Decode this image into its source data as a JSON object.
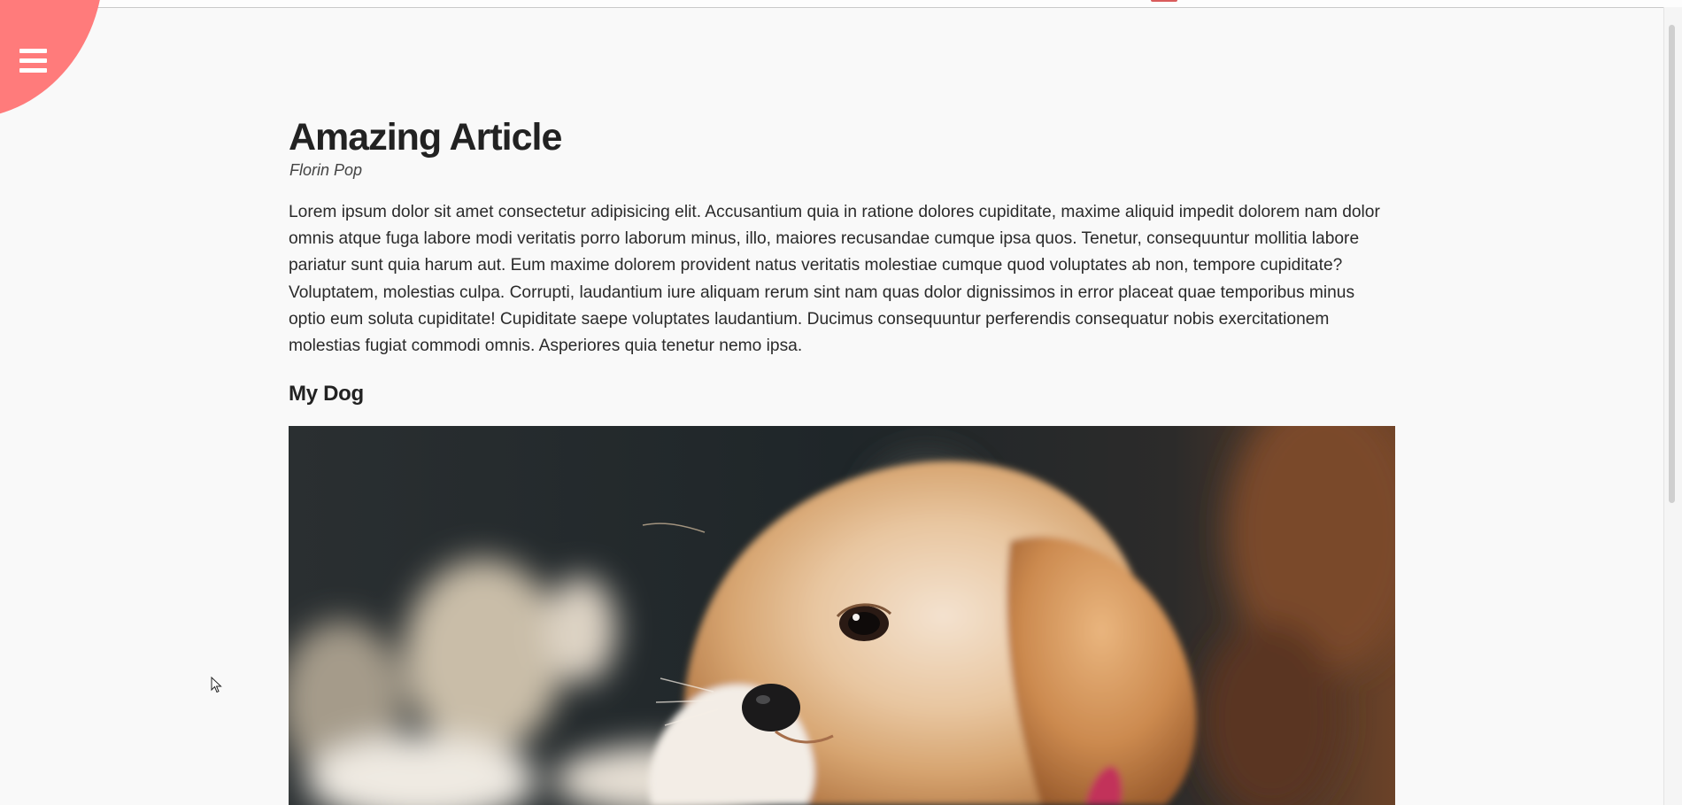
{
  "menu": {
    "icon": "hamburger-menu-icon",
    "accent_color": "#ff7b7b"
  },
  "article": {
    "title": "Amazing Article",
    "author": "Florin Pop",
    "body": "Lorem ipsum dolor sit amet consectetur adipisicing elit. Accusantium quia in ratione dolores cupiditate, maxime aliquid impedit dolorem nam dolor omnis atque fuga labore modi veritatis porro laborum minus, illo, maiores recusandae cumque ipsa quos. Tenetur, consequuntur mollitia labore pariatur sunt quia harum aut. Eum maxime dolorem provident natus veritatis molestiae cumque quod voluptates ab non, tempore cupiditate? Voluptatem, molestias culpa. Corrupti, laudantium iure aliquam rerum sint nam quas dolor dignissimos in error placeat quae temporibus minus optio eum soluta cupiditate! Cupiditate saepe voluptates laudantium. Ducimus consequuntur perferendis consequatur nobis exercitationem molestias fugiat commodi omnis. Asperiores quia tenetur nemo ipsa.",
    "subtitle": "My Dog"
  },
  "image": {
    "subject": "puppy"
  }
}
